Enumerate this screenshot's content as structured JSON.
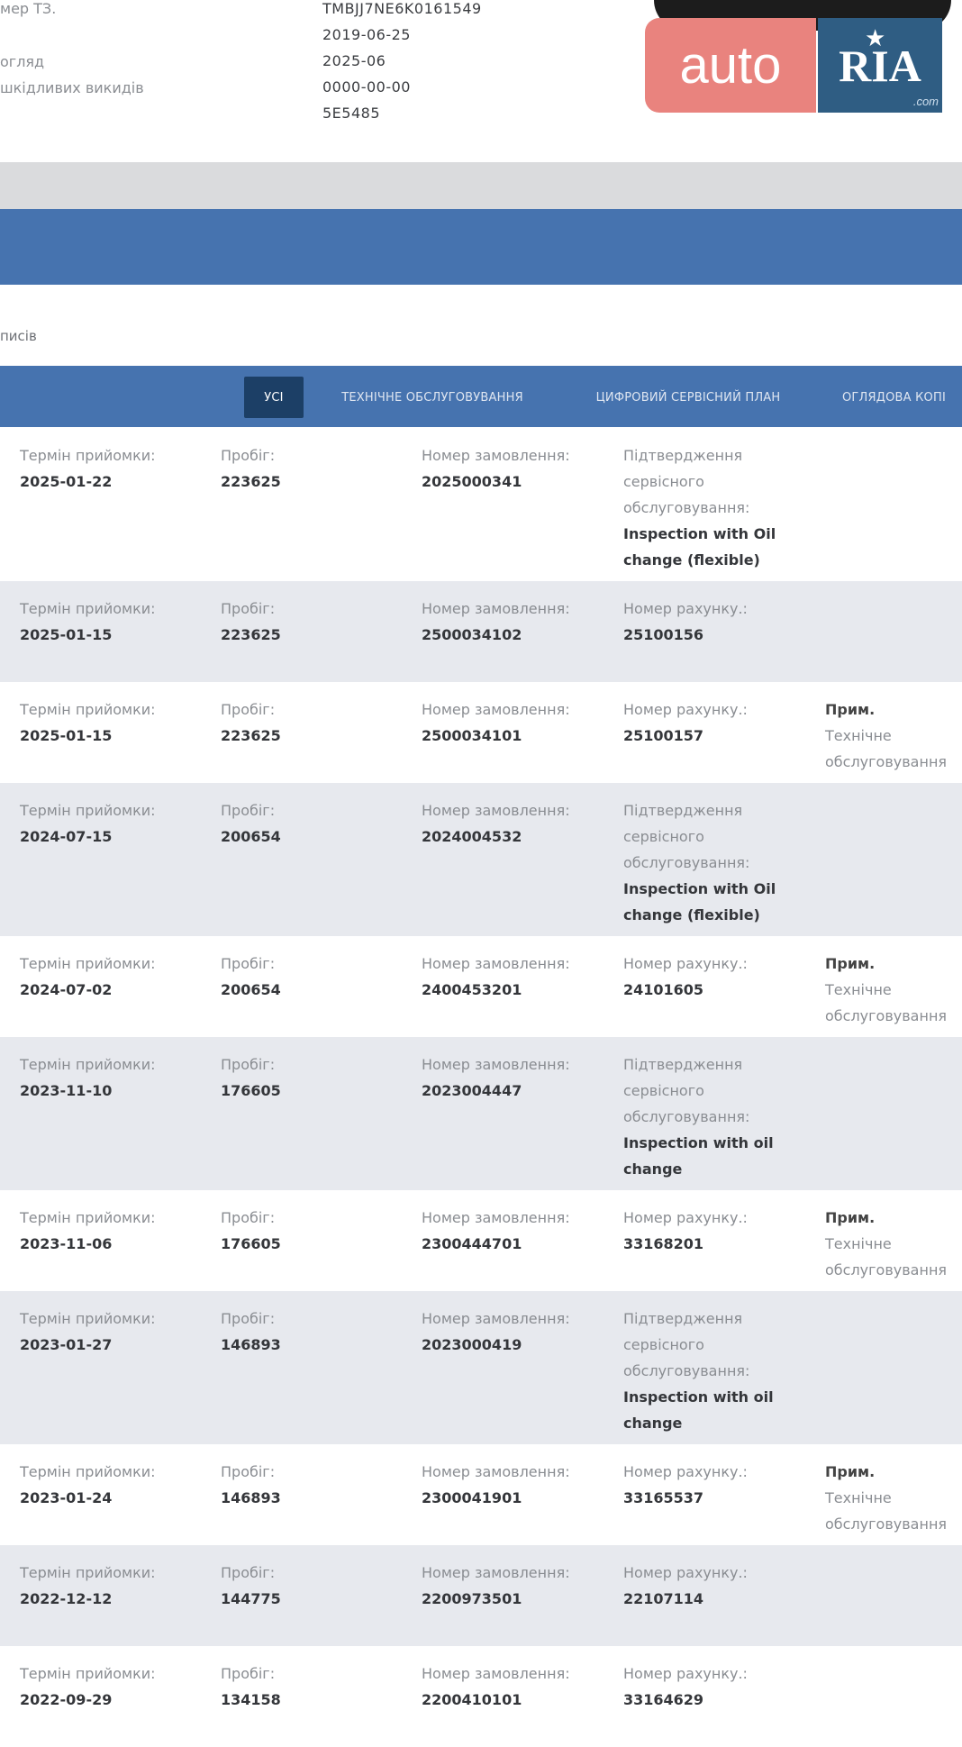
{
  "vehicle": {
    "fields": [
      {
        "label": "мер ТЗ.",
        "value": "TMBJJ7NE6K0161549"
      },
      {
        "label": "",
        "value": "2019-06-25"
      },
      {
        "label": "огляд",
        "value": "2025-06"
      },
      {
        "label": "шкідливих викидів",
        "value": "0000-00-00"
      },
      {
        "label": "",
        "value": "5E5485"
      }
    ]
  },
  "logo": {
    "auto": "auto",
    "ria": "RIA",
    "com": ".com"
  },
  "section_subtitle": "писів",
  "tabs": [
    {
      "label": "УСІ",
      "active": true
    },
    {
      "label": "ТЕХНІЧНЕ ОБСЛУГОВУВАННЯ",
      "active": false
    },
    {
      "label": "ЦИФРОВИЙ СЕРВІСНИЙ ПЛАН",
      "active": false
    },
    {
      "label": "ОГЛЯДОВА КОПІ",
      "active": false
    }
  ],
  "labels": {
    "date": "Термін прийомки:",
    "mileage": "Пробіг:",
    "order": "Номер замовлення:",
    "invoice": "Номер рахунку.:",
    "confirm": "Підтвердження сервісного обслуговування:",
    "note": "Прим.",
    "note_val": "Технічне обслуговування"
  },
  "records": [
    {
      "date": "2025-01-22",
      "mileage": "223625",
      "order": "2025000341",
      "kind": "confirm",
      "value": "Inspection with Oil change (flexible)",
      "note": false
    },
    {
      "date": "2025-01-15",
      "mileage": "223625",
      "order": "2500034102",
      "kind": "invoice",
      "value": "25100156",
      "note": false
    },
    {
      "date": "2025-01-15",
      "mileage": "223625",
      "order": "2500034101",
      "kind": "invoice",
      "value": "25100157",
      "note": true
    },
    {
      "date": "2024-07-15",
      "mileage": "200654",
      "order": "2024004532",
      "kind": "confirm",
      "value": "Inspection with Oil change (flexible)",
      "note": false
    },
    {
      "date": "2024-07-02",
      "mileage": "200654",
      "order": "2400453201",
      "kind": "invoice",
      "value": "24101605",
      "note": true
    },
    {
      "date": "2023-11-10",
      "mileage": "176605",
      "order": "2023004447",
      "kind": "confirm",
      "value": "Inspection with oil change",
      "note": false
    },
    {
      "date": "2023-11-06",
      "mileage": "176605",
      "order": "2300444701",
      "kind": "invoice",
      "value": "33168201",
      "note": true
    },
    {
      "date": "2023-01-27",
      "mileage": "146893",
      "order": "2023000419",
      "kind": "confirm",
      "value": "Inspection with oil change",
      "note": false
    },
    {
      "date": "2023-01-24",
      "mileage": "146893",
      "order": "2300041901",
      "kind": "invoice",
      "value": "33165537",
      "note": true
    },
    {
      "date": "2022-12-12",
      "mileage": "144775",
      "order": "2200973501",
      "kind": "invoice",
      "value": "22107114",
      "note": false
    },
    {
      "date": "2022-09-29",
      "mileage": "134158",
      "order": "2200410101",
      "kind": "invoice",
      "value": "33164629",
      "note": false
    }
  ]
}
